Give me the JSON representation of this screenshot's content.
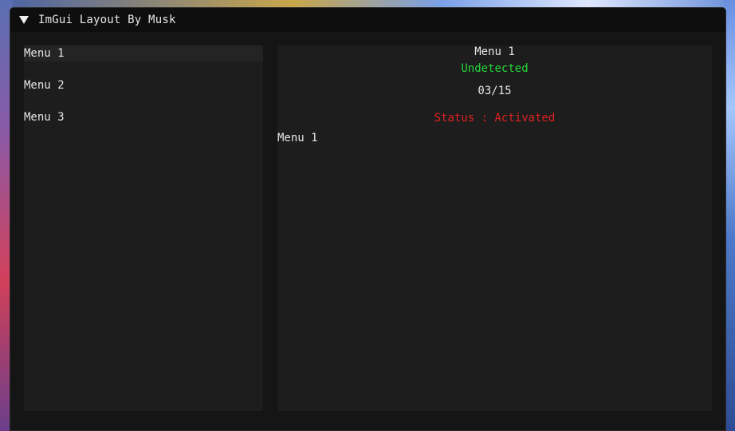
{
  "window": {
    "title": "ImGui Layout By Musk"
  },
  "sidebar": {
    "items": [
      {
        "label": "Menu 1",
        "selected": true
      },
      {
        "label": "Menu 2",
        "selected": false
      },
      {
        "label": "Menu 3",
        "selected": false
      }
    ]
  },
  "main": {
    "header": "Menu 1",
    "detection_status": "Undetected",
    "date": "03/15",
    "status": "Status : Activated",
    "content_label": "Menu 1"
  },
  "colors": {
    "window_bg": "#151515",
    "titlebar_bg": "#0e0e0e",
    "panel_bg": "#1d1d1d",
    "text": "#e6e6e6",
    "undetected_green": "#22d83a",
    "status_red": "#e02020"
  },
  "icons": {
    "collapse": "triangle-down-icon"
  }
}
